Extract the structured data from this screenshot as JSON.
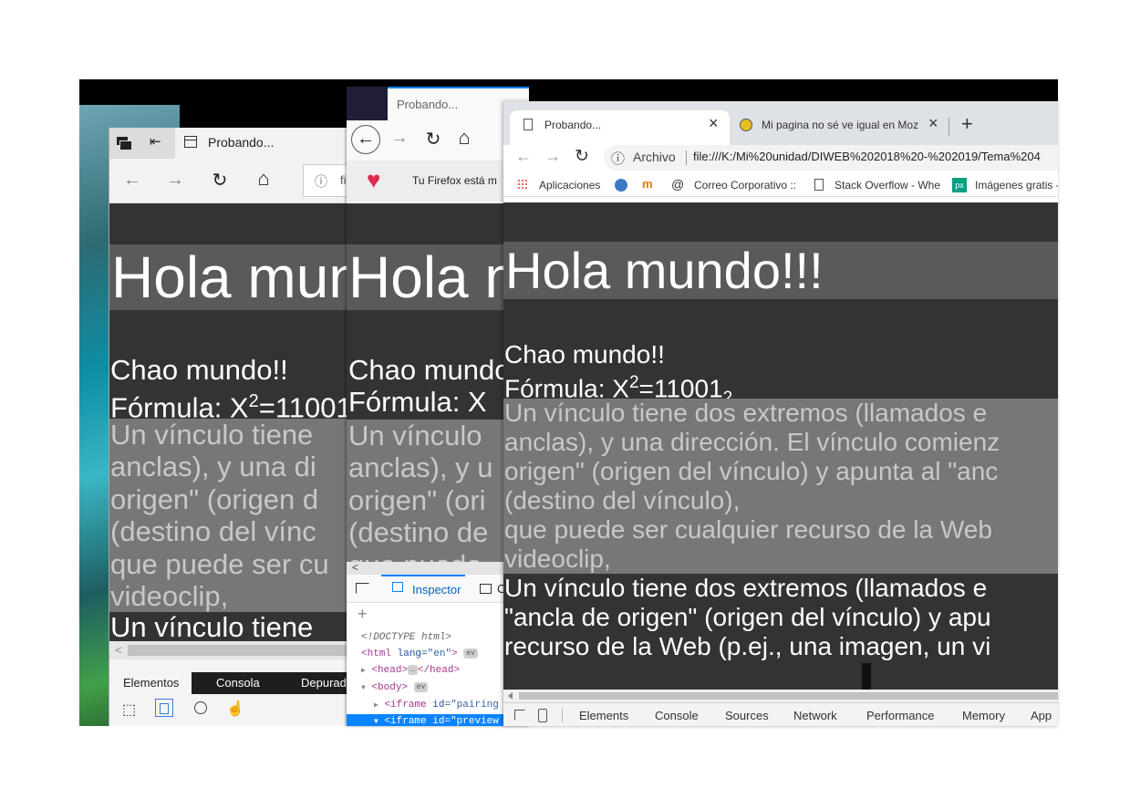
{
  "content": {
    "h1": "Hola mundo!!!",
    "chao": "Chao mundo!!",
    "formula_prefix": "Fórmula: X",
    "formula_sup": "2",
    "formula_eq": "=11001",
    "formula_sub": "2",
    "p1_lines": [
      "Un vínculo tiene dos extremos (llamados e",
      "anclas), y una dirección. El vínculo comienz",
      "origen\" (origen del vínculo) y apunta al \"anc",
      "(destino del vínculo),",
      "que puede ser cualquier recurso de la Web",
      "videoclip,"
    ],
    "p2_lines": [
      "Un vínculo tiene dos extremos (llamados e",
      "\"ancla de origen\" (origen del vínculo) y apu",
      "recurso de la Web (p.ej., una imagen, un vi"
    ],
    "edge_p1_lines": [
      "Un vínculo tiene",
      "anclas), y una di",
      "origen\" (origen d",
      "(destino del vínc",
      "que puede ser cu",
      "videoclip,"
    ],
    "edge_p2_line": "Un vínculo tiene",
    "ff_p1_lines": [
      "Un vínculo",
      "anclas), y u",
      "origen\" (ori",
      "(destino de",
      "que puede"
    ]
  },
  "edge": {
    "tab_title": "Probando...",
    "info_icon": "i",
    "url_partial": "fi",
    "devtools_tabs": [
      "Elementos",
      "Consola",
      "Depurad"
    ]
  },
  "firefox": {
    "tab_title": "Probando...",
    "notice": "Tu Firefox está m",
    "devtools_tab": "Inspector",
    "devtools_tab2_partial": "C",
    "add_node": "+",
    "dom": {
      "doctype": "<!DOCTYPE html>",
      "html_open": "<html",
      "lang_attr": "lang=",
      "lang_val": "\"en\"",
      "html_close": ">",
      "ev": "ev",
      "head_open": "<head>",
      "head_dots": "…",
      "head_close": "</head>",
      "body": "<body>",
      "iframe1_open": "<iframe ",
      "iframe1_attr": "id=",
      "iframe1_val": "\"pairing",
      "iframe2_open": "<iframe ",
      "iframe2_attr": "id=",
      "iframe2_val": "\"preview"
    }
  },
  "chrome": {
    "tabs": [
      {
        "title": "Probando...",
        "close": "×"
      },
      {
        "title": "Mi pagina no sé ve igual en Moz",
        "close": "×"
      }
    ],
    "new_tab": "+",
    "archivo": "Archivo",
    "url": "file:///K:/Mi%20unidad/DIWEB%202018%20-%202019/Tema%204",
    "bookmarks": [
      "Aplicaciones",
      "Correo Corporativo ::",
      "Stack Overflow - Whe",
      "Imágenes gratis -"
    ],
    "devtools_tabs": [
      "Elements",
      "Console",
      "Sources",
      "Network",
      "Performance",
      "Memory",
      "App"
    ]
  },
  "icons": {
    "back": "←",
    "forward": "→",
    "reload": "↻",
    "home": "⌂",
    "info": "ⓘ",
    "close": "×",
    "plus": "+",
    "heart": "♥",
    "page": "🗋",
    "triangle": "▶",
    "down_triangle": "▼",
    "left_arrow": "<"
  },
  "colors": {
    "page_bg": "#333333",
    "h1_bg": "#5a5a5a",
    "paragraph_gray_bg": "#777777",
    "paragraph_gray_text": "#c8c8c8",
    "firefox_accent": "#0a84ff",
    "edge_devtools_active": "#1e1e1e"
  }
}
